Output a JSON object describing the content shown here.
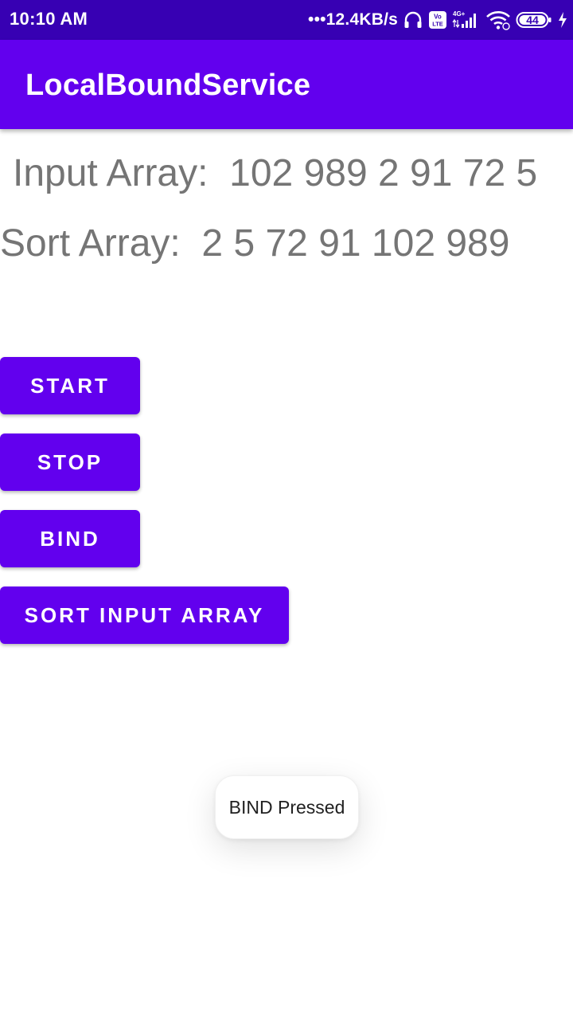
{
  "status_bar": {
    "time": "10:10 AM",
    "network_speed": "•••12.4KB/s",
    "volte_label": "Vo LTE",
    "signal_label": "4G+",
    "battery_level": "44",
    "background_color": "#3700b3"
  },
  "app_bar": {
    "title": "LocalBoundService",
    "background_color": "#6200ee"
  },
  "content": {
    "input_array_label": "Input Array:",
    "input_array_values": "102 989 2 91 72 5",
    "sort_array_label": "Sort Array:",
    "sort_array_values": "2 5 72 91 102 989"
  },
  "buttons": {
    "start": "START",
    "stop": "STOP",
    "bind": "BIND",
    "sort_input_array": "SORT INPUT ARRAY"
  },
  "toast": {
    "message": "BIND Pressed"
  },
  "icons": {
    "headphones": "headphones-icon",
    "volte": "volte-icon",
    "signal": "signal-icon",
    "wifi": "wifi-icon",
    "battery": "battery-icon",
    "charging": "charging-bolt-icon"
  }
}
